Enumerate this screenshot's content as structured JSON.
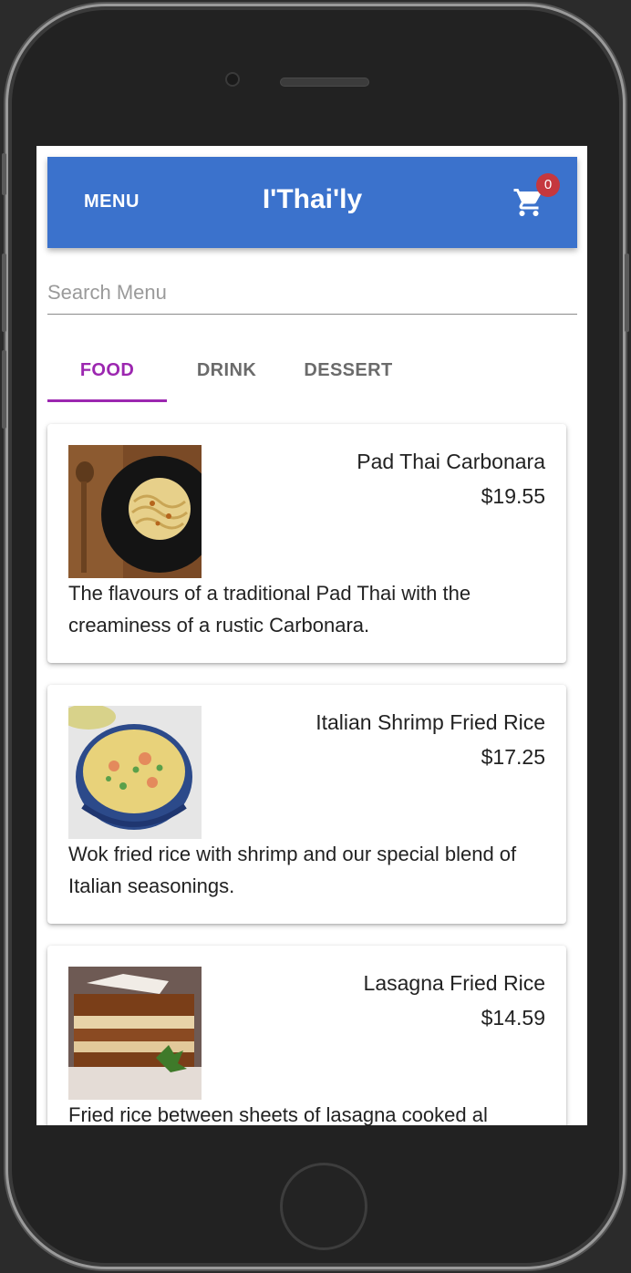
{
  "header": {
    "menu_label": "MENU",
    "title": "I'Thai'ly",
    "cart_icon": "shopping-cart-icon",
    "cart_count": "0"
  },
  "search": {
    "placeholder": "Search Menu",
    "value": ""
  },
  "tabs": [
    {
      "label": "FOOD",
      "active": true
    },
    {
      "label": "DRINK",
      "active": false
    },
    {
      "label": "DESSERT",
      "active": false
    }
  ],
  "items": [
    {
      "name": "Pad Thai Carbonara",
      "price": "$19.55",
      "description": "The flavours of a traditional Pad Thai with the creaminess of a rustic Carbonara."
    },
    {
      "name": "Italian Shrimp Fried Rice",
      "price": "$17.25",
      "description": "Wok fried rice with shrimp and our special blend of Italian seasonings."
    },
    {
      "name": "Lasagna Fried Rice",
      "price": "$14.59",
      "description": "Fried rice between sheets of lasagna cooked al"
    }
  ],
  "colors": {
    "appbar": "#3b72cc",
    "tab_active": "#9c27b0",
    "badge": "#c5383e"
  }
}
